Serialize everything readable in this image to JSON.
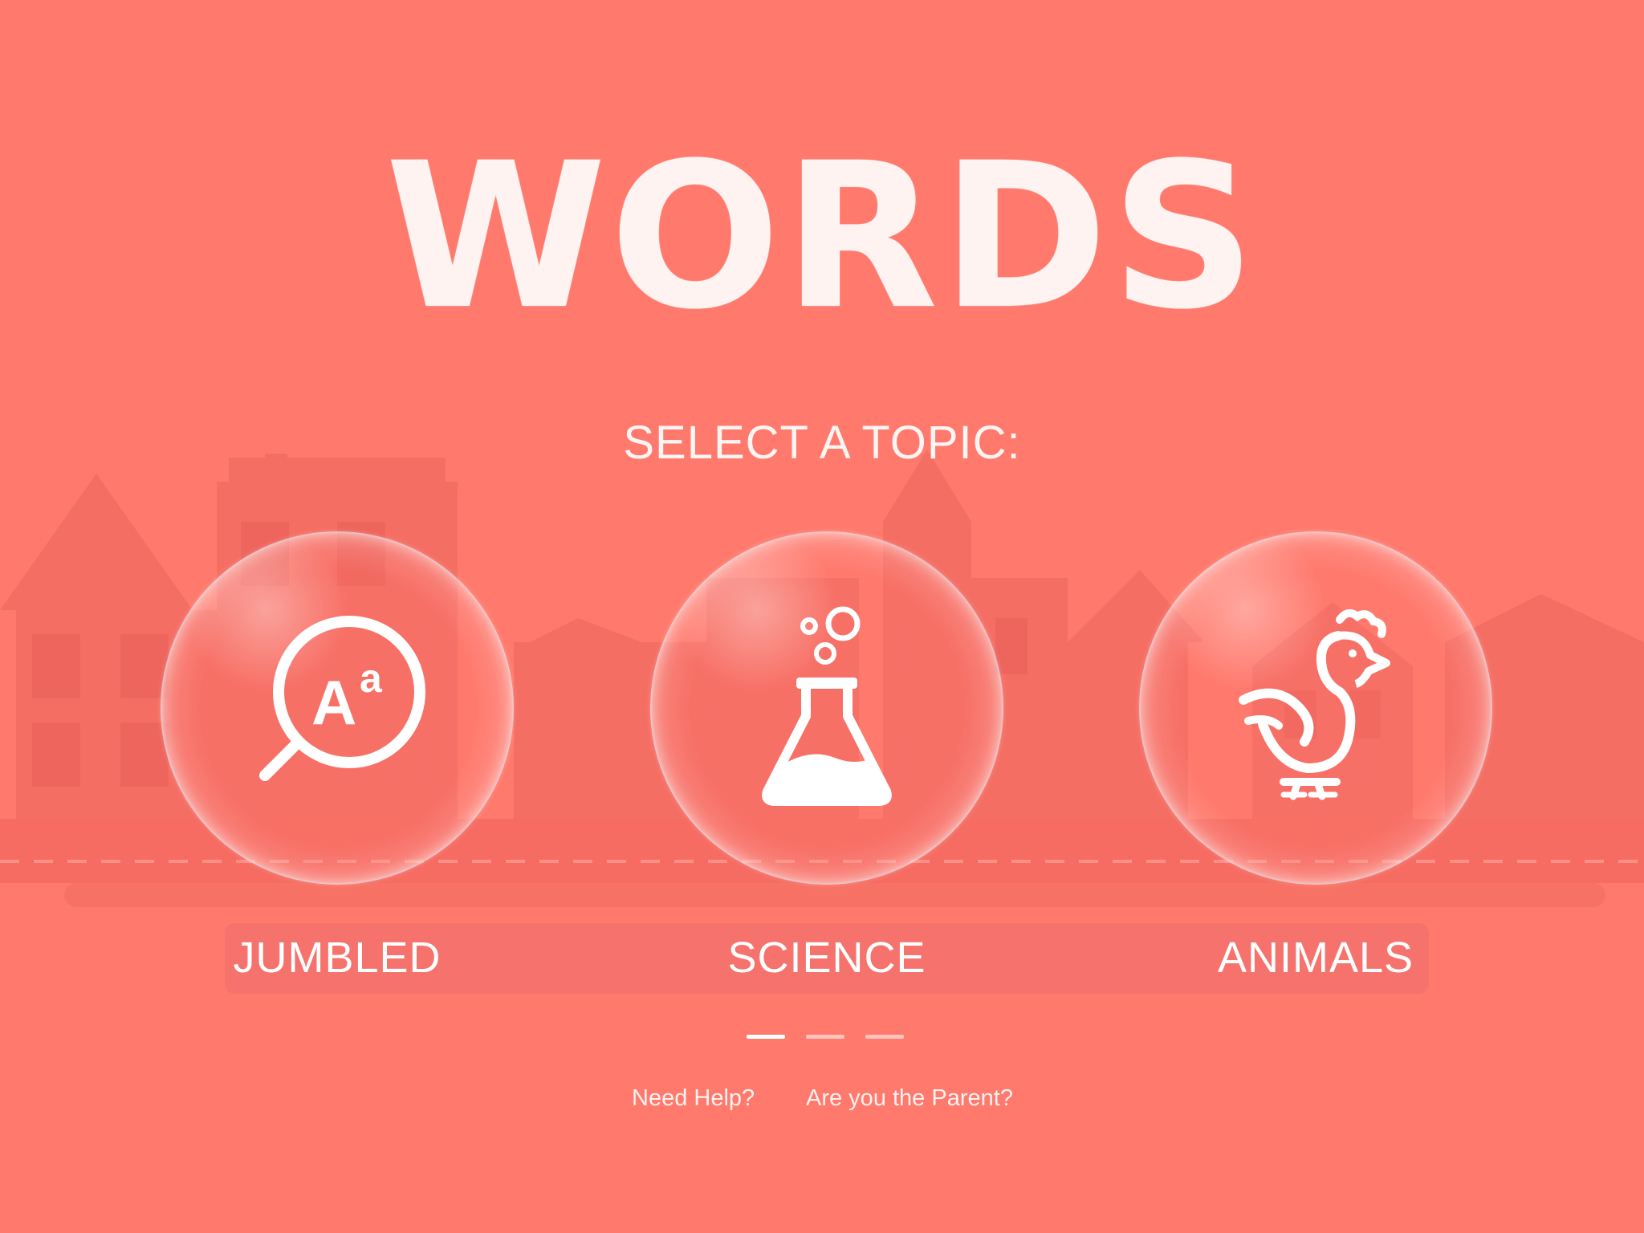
{
  "app": {
    "title": "WORDS",
    "prompt": "SELECT A TOPIC:"
  },
  "topics": [
    {
      "label": "JUMBLED",
      "icon": "magnifier-letters-icon"
    },
    {
      "label": "SCIENCE",
      "icon": "flask-icon"
    },
    {
      "label": "ANIMALS",
      "icon": "chicken-icon"
    }
  ],
  "pager": {
    "pages": 3,
    "current": 1
  },
  "footer": {
    "help": "Need Help?",
    "parent": "Are you the Parent?"
  },
  "colors": {
    "background": "#ff7a6d",
    "buildings": "#f2665e",
    "text": "#ffffff"
  }
}
